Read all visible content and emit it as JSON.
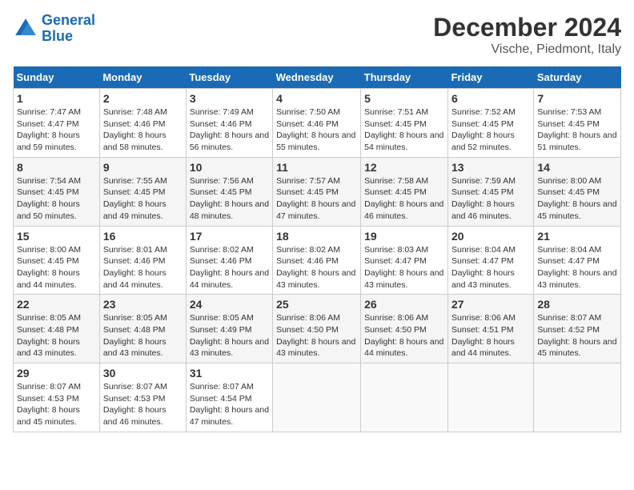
{
  "header": {
    "logo_line1": "General",
    "logo_line2": "Blue",
    "title": "December 2024",
    "subtitle": "Vische, Piedmont, Italy"
  },
  "weekdays": [
    "Sunday",
    "Monday",
    "Tuesday",
    "Wednesday",
    "Thursday",
    "Friday",
    "Saturday"
  ],
  "weeks": [
    [
      {
        "day": "1",
        "sunrise": "7:47 AM",
        "sunset": "4:47 PM",
        "daylight": "8 hours and 59 minutes."
      },
      {
        "day": "2",
        "sunrise": "7:48 AM",
        "sunset": "4:46 PM",
        "daylight": "8 hours and 58 minutes."
      },
      {
        "day": "3",
        "sunrise": "7:49 AM",
        "sunset": "4:46 PM",
        "daylight": "8 hours and 56 minutes."
      },
      {
        "day": "4",
        "sunrise": "7:50 AM",
        "sunset": "4:46 PM",
        "daylight": "8 hours and 55 minutes."
      },
      {
        "day": "5",
        "sunrise": "7:51 AM",
        "sunset": "4:45 PM",
        "daylight": "8 hours and 54 minutes."
      },
      {
        "day": "6",
        "sunrise": "7:52 AM",
        "sunset": "4:45 PM",
        "daylight": "8 hours and 52 minutes."
      },
      {
        "day": "7",
        "sunrise": "7:53 AM",
        "sunset": "4:45 PM",
        "daylight": "8 hours and 51 minutes."
      }
    ],
    [
      {
        "day": "8",
        "sunrise": "7:54 AM",
        "sunset": "4:45 PM",
        "daylight": "8 hours and 50 minutes."
      },
      {
        "day": "9",
        "sunrise": "7:55 AM",
        "sunset": "4:45 PM",
        "daylight": "8 hours and 49 minutes."
      },
      {
        "day": "10",
        "sunrise": "7:56 AM",
        "sunset": "4:45 PM",
        "daylight": "8 hours and 48 minutes."
      },
      {
        "day": "11",
        "sunrise": "7:57 AM",
        "sunset": "4:45 PM",
        "daylight": "8 hours and 47 minutes."
      },
      {
        "day": "12",
        "sunrise": "7:58 AM",
        "sunset": "4:45 PM",
        "daylight": "8 hours and 46 minutes."
      },
      {
        "day": "13",
        "sunrise": "7:59 AM",
        "sunset": "4:45 PM",
        "daylight": "8 hours and 46 minutes."
      },
      {
        "day": "14",
        "sunrise": "8:00 AM",
        "sunset": "4:45 PM",
        "daylight": "8 hours and 45 minutes."
      }
    ],
    [
      {
        "day": "15",
        "sunrise": "8:00 AM",
        "sunset": "4:45 PM",
        "daylight": "8 hours and 44 minutes."
      },
      {
        "day": "16",
        "sunrise": "8:01 AM",
        "sunset": "4:46 PM",
        "daylight": "8 hours and 44 minutes."
      },
      {
        "day": "17",
        "sunrise": "8:02 AM",
        "sunset": "4:46 PM",
        "daylight": "8 hours and 44 minutes."
      },
      {
        "day": "18",
        "sunrise": "8:02 AM",
        "sunset": "4:46 PM",
        "daylight": "8 hours and 43 minutes."
      },
      {
        "day": "19",
        "sunrise": "8:03 AM",
        "sunset": "4:47 PM",
        "daylight": "8 hours and 43 minutes."
      },
      {
        "day": "20",
        "sunrise": "8:04 AM",
        "sunset": "4:47 PM",
        "daylight": "8 hours and 43 minutes."
      },
      {
        "day": "21",
        "sunrise": "8:04 AM",
        "sunset": "4:47 PM",
        "daylight": "8 hours and 43 minutes."
      }
    ],
    [
      {
        "day": "22",
        "sunrise": "8:05 AM",
        "sunset": "4:48 PM",
        "daylight": "8 hours and 43 minutes."
      },
      {
        "day": "23",
        "sunrise": "8:05 AM",
        "sunset": "4:48 PM",
        "daylight": "8 hours and 43 minutes."
      },
      {
        "day": "24",
        "sunrise": "8:05 AM",
        "sunset": "4:49 PM",
        "daylight": "8 hours and 43 minutes."
      },
      {
        "day": "25",
        "sunrise": "8:06 AM",
        "sunset": "4:50 PM",
        "daylight": "8 hours and 43 minutes."
      },
      {
        "day": "26",
        "sunrise": "8:06 AM",
        "sunset": "4:50 PM",
        "daylight": "8 hours and 44 minutes."
      },
      {
        "day": "27",
        "sunrise": "8:06 AM",
        "sunset": "4:51 PM",
        "daylight": "8 hours and 44 minutes."
      },
      {
        "day": "28",
        "sunrise": "8:07 AM",
        "sunset": "4:52 PM",
        "daylight": "8 hours and 45 minutes."
      }
    ],
    [
      {
        "day": "29",
        "sunrise": "8:07 AM",
        "sunset": "4:53 PM",
        "daylight": "8 hours and 45 minutes."
      },
      {
        "day": "30",
        "sunrise": "8:07 AM",
        "sunset": "4:53 PM",
        "daylight": "8 hours and 46 minutes."
      },
      {
        "day": "31",
        "sunrise": "8:07 AM",
        "sunset": "4:54 PM",
        "daylight": "8 hours and 47 minutes."
      },
      null,
      null,
      null,
      null
    ]
  ]
}
